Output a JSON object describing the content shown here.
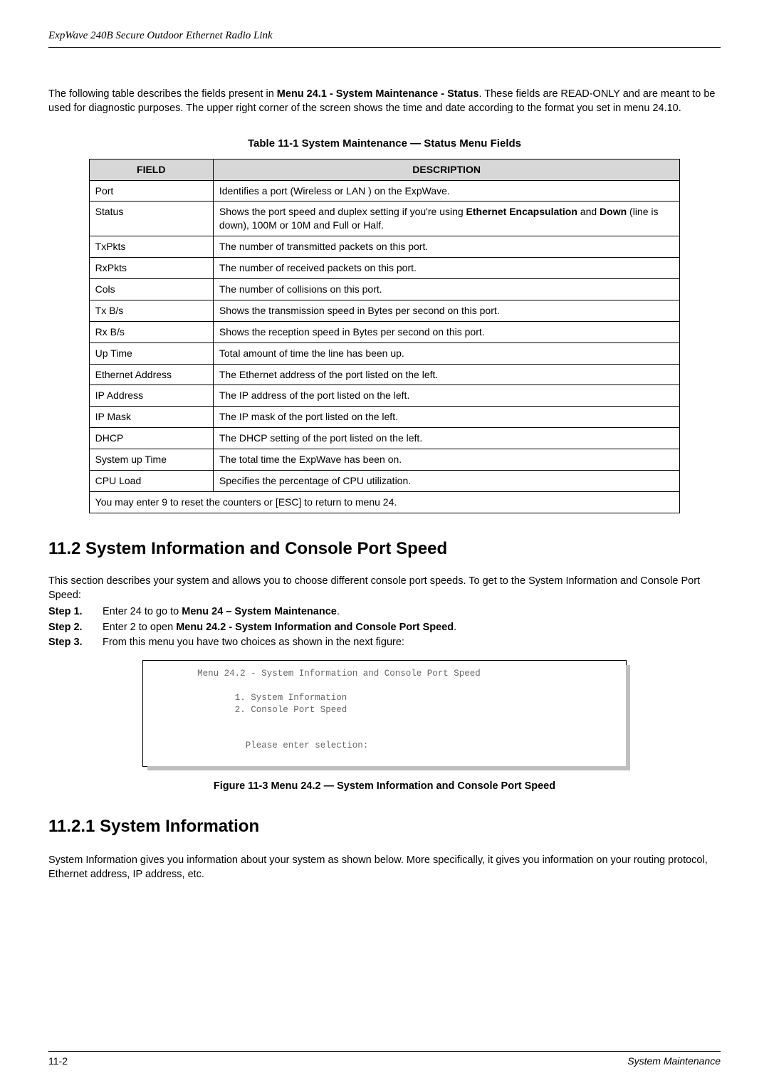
{
  "header": {
    "running_title": "ExpWave 240B Secure Outdoor Ethernet Radio Link"
  },
  "intro": {
    "pre1": "The following table describes the fields present in ",
    "bold1": "Menu 24.1 - System Maintenance - Status",
    "post1": ". These fields are READ-ONLY and are meant to be used for diagnostic purposes. The upper right corner of the screen shows the time and date according to the format you set in menu 24.10."
  },
  "table_caption": "Table 11-1 System Maintenance — Status Menu Fields",
  "table": {
    "head_field": "FIELD",
    "head_desc": "DESCRIPTION",
    "rows": [
      {
        "field": "Port",
        "desc_plain": "Identifies a port (Wireless or LAN ) on the ExpWave."
      },
      {
        "field": "Status",
        "desc_pre": "Shows the port speed and duplex setting if you're using ",
        "desc_b1": "Ethernet Encapsulation",
        "desc_mid": " and ",
        "desc_b2": "Down",
        "desc_post": " (line is down), 100M or 10M and Full or Half."
      },
      {
        "field": "TxPkts",
        "desc_plain": "The number of transmitted packets on this port."
      },
      {
        "field": "RxPkts",
        "desc_plain": "The number of received packets on this port."
      },
      {
        "field": "Cols",
        "desc_plain": "The number of collisions on this port."
      },
      {
        "field": "Tx B/s",
        "desc_plain": "Shows the transmission speed in Bytes per second on this port."
      },
      {
        "field": "Rx B/s",
        "desc_plain": "Shows the reception speed in Bytes per second on this port."
      },
      {
        "field": "Up Time",
        "desc_plain": "Total amount of time the line has been up."
      },
      {
        "field": "Ethernet Address",
        "desc_plain": "The Ethernet address of the port listed on the left."
      },
      {
        "field": "IP Address",
        "desc_plain": "The IP address of the port listed on the left."
      },
      {
        "field": "IP Mask",
        "desc_plain": "The IP mask of the port listed on the left."
      },
      {
        "field": "DHCP",
        "desc_plain": "The DHCP setting of the port listed on the left."
      },
      {
        "field": "System up Time",
        "desc_plain": "The total time the ExpWave has been on."
      },
      {
        "field": "CPU Load",
        "desc_plain": "Specifies the percentage of CPU utilization."
      }
    ],
    "footer_row": "You may enter 9 to reset the counters or [ESC] to return to menu 24."
  },
  "section_11_2": {
    "heading": "11.2 System Information and Console Port Speed",
    "body": "This section describes your system and allows you to choose different console port speeds. To get to the System Information and Console Port Speed:",
    "steps": [
      {
        "label": "Step 1.",
        "pre": "Enter 24 to go to ",
        "bold": "Menu 24 – System Maintenance",
        "post": "."
      },
      {
        "label": "Step 2.",
        "pre": "Enter 2 to open ",
        "bold": "Menu 24.2 -   System Information and Console Port Speed",
        "post": "."
      },
      {
        "label": "Step 3.",
        "pre": "From this menu you have two choices as shown in the next figure:",
        "bold": "",
        "post": ""
      }
    ]
  },
  "terminal": {
    "line1": "Menu 24.2 - System Information and Console Port Speed",
    "line2": "1. System Information",
    "line3": "2. Console Port Speed",
    "line4": "Please enter selection:"
  },
  "figure_caption": "Figure 11-3 Menu 24.2 — System Information and Console Port Speed",
  "section_11_2_1": {
    "heading": "11.2.1 System Information",
    "body": "System Information gives you information about your system as shown below. More specifically, it gives you information on your routing protocol, Ethernet address, IP address, etc."
  },
  "footer": {
    "left": "11-2",
    "right": "System Maintenance"
  }
}
